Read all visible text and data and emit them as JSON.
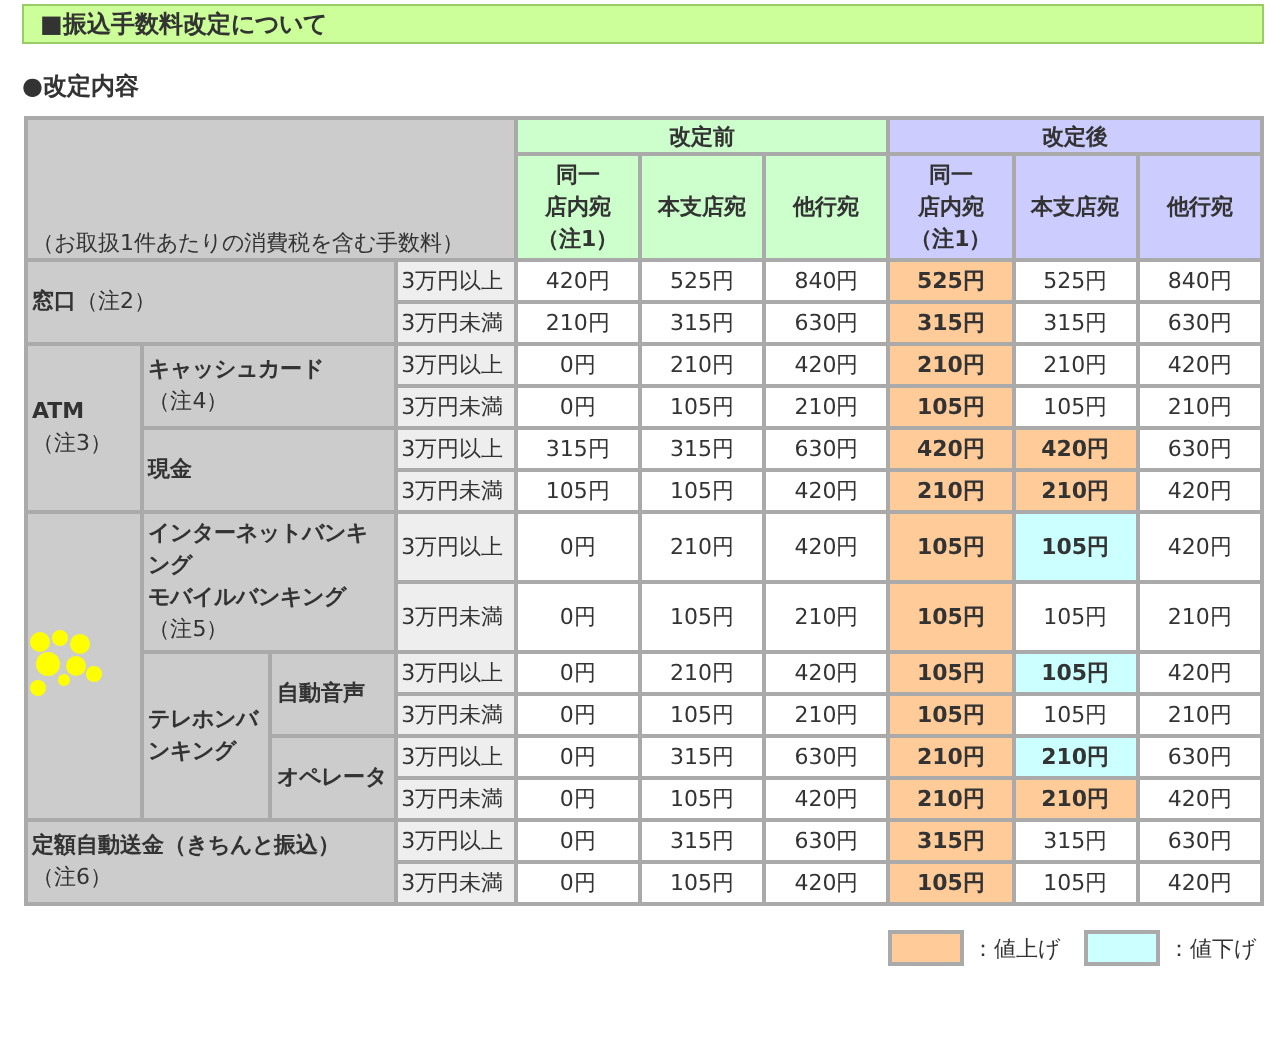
{
  "title": "■振込手数料改定について",
  "section_heading": "●改定内容",
  "table": {
    "corner_note": "（お取扱1件あたりの消費税を含む手数料）",
    "groups": [
      {
        "label": "改定前",
        "kind": "before"
      },
      {
        "label": "改定後",
        "kind": "after"
      }
    ],
    "columns": [
      {
        "lines": [
          "同一",
          "店内宛",
          "（注1）"
        ],
        "kind": "before"
      },
      {
        "lines": [
          "本支店宛"
        ],
        "kind": "before"
      },
      {
        "lines": [
          "他行宛"
        ],
        "kind": "before"
      },
      {
        "lines": [
          "同一",
          "店内宛",
          "（注1）"
        ],
        "kind": "after"
      },
      {
        "lines": [
          "本支店宛"
        ],
        "kind": "after"
      },
      {
        "lines": [
          "他行宛"
        ],
        "kind": "after"
      }
    ],
    "rows": [
      {
        "labels": [
          {
            "kind": "inline_note",
            "lines": [
              "窓口"
            ],
            "note": "（注2）",
            "rowspan": 2,
            "colspan": 3
          }
        ],
        "threshold": "3万円以上",
        "before": [
          "420円",
          "525円",
          "840円"
        ],
        "after": [
          {
            "value": "525円",
            "raised": true,
            "lowered": false
          },
          {
            "value": "525円",
            "raised": false,
            "lowered": false
          },
          {
            "value": "840円",
            "raised": false,
            "lowered": false
          }
        ]
      },
      {
        "threshold": "3万円未満",
        "before": [
          "210円",
          "315円",
          "630円"
        ],
        "after": [
          {
            "value": "315円",
            "raised": true,
            "lowered": false
          },
          {
            "value": "315円",
            "raised": false,
            "lowered": false
          },
          {
            "value": "630円",
            "raised": false,
            "lowered": false
          }
        ]
      },
      {
        "labels": [
          {
            "kind": "text",
            "lines": [
              "ATM"
            ],
            "note": "（注3）",
            "rowspan": 4
          },
          {
            "kind": "text",
            "lines": [
              "キャッシュカード"
            ],
            "note": "（注4）",
            "rowspan": 2,
            "colspan": 2
          }
        ],
        "threshold": "3万円以上",
        "before": [
          "0円",
          "210円",
          "420円"
        ],
        "after": [
          {
            "value": "210円",
            "raised": true,
            "lowered": false
          },
          {
            "value": "210円",
            "raised": false,
            "lowered": false
          },
          {
            "value": "420円",
            "raised": false,
            "lowered": false
          }
        ]
      },
      {
        "threshold": "3万円未満",
        "before": [
          "0円",
          "105円",
          "210円"
        ],
        "after": [
          {
            "value": "105円",
            "raised": true,
            "lowered": false
          },
          {
            "value": "105円",
            "raised": false,
            "lowered": false
          },
          {
            "value": "210円",
            "raised": false,
            "lowered": false
          }
        ]
      },
      {
        "labels": [
          {
            "kind": "text",
            "lines": [
              "現金"
            ],
            "rowspan": 2,
            "colspan": 2
          }
        ],
        "threshold": "3万円以上",
        "before": [
          "315円",
          "315円",
          "630円"
        ],
        "after": [
          {
            "value": "420円",
            "raised": true,
            "lowered": false
          },
          {
            "value": "420円",
            "raised": true,
            "lowered": false
          },
          {
            "value": "630円",
            "raised": false,
            "lowered": false
          }
        ]
      },
      {
        "threshold": "3万円未満",
        "before": [
          "105円",
          "105円",
          "420円"
        ],
        "after": [
          {
            "value": "210円",
            "raised": true,
            "lowered": false
          },
          {
            "value": "210円",
            "raised": true,
            "lowered": false
          },
          {
            "value": "420円",
            "raised": false,
            "lowered": false
          }
        ]
      },
      {
        "labels": [
          {
            "kind": "blank",
            "rowspan": 6
          },
          {
            "kind": "text",
            "lines": [
              "インターネットバンキング",
              "モバイルバンキング"
            ],
            "note": "（注5）",
            "rowspan": 2,
            "colspan": 2
          }
        ],
        "threshold": "3万円以上",
        "before": [
          "0円",
          "210円",
          "420円"
        ],
        "after": [
          {
            "value": "105円",
            "raised": true,
            "lowered": false
          },
          {
            "value": "105円",
            "raised": false,
            "lowered": true
          },
          {
            "value": "420円",
            "raised": false,
            "lowered": false
          }
        ]
      },
      {
        "threshold": "3万円未満",
        "before": [
          "0円",
          "105円",
          "210円"
        ],
        "after": [
          {
            "value": "105円",
            "raised": true,
            "lowered": false
          },
          {
            "value": "105円",
            "raised": false,
            "lowered": false
          },
          {
            "value": "210円",
            "raised": false,
            "lowered": false
          }
        ]
      },
      {
        "labels": [
          {
            "kind": "text",
            "lines": [
              "テレホンバンキング"
            ],
            "rowspan": 4
          },
          {
            "kind": "text",
            "lines": [
              "自動音声"
            ],
            "rowspan": 2
          }
        ],
        "threshold": "3万円以上",
        "before": [
          "0円",
          "210円",
          "420円"
        ],
        "after": [
          {
            "value": "105円",
            "raised": true,
            "lowered": false
          },
          {
            "value": "105円",
            "raised": false,
            "lowered": true
          },
          {
            "value": "420円",
            "raised": false,
            "lowered": false
          }
        ]
      },
      {
        "threshold": "3万円未満",
        "before": [
          "0円",
          "105円",
          "210円"
        ],
        "after": [
          {
            "value": "105円",
            "raised": true,
            "lowered": false
          },
          {
            "value": "105円",
            "raised": false,
            "lowered": false
          },
          {
            "value": "210円",
            "raised": false,
            "lowered": false
          }
        ]
      },
      {
        "labels": [
          {
            "kind": "text",
            "lines": [
              "オペレータ"
            ],
            "rowspan": 2
          }
        ],
        "threshold": "3万円以上",
        "before": [
          "0円",
          "315円",
          "630円"
        ],
        "after": [
          {
            "value": "210円",
            "raised": true,
            "lowered": false
          },
          {
            "value": "210円",
            "raised": false,
            "lowered": true
          },
          {
            "value": "630円",
            "raised": false,
            "lowered": false
          }
        ]
      },
      {
        "threshold": "3万円未満",
        "before": [
          "0円",
          "105円",
          "420円"
        ],
        "after": [
          {
            "value": "210円",
            "raised": true,
            "lowered": false
          },
          {
            "value": "210円",
            "raised": true,
            "lowered": false
          },
          {
            "value": "420円",
            "raised": false,
            "lowered": false
          }
        ]
      },
      {
        "labels": [
          {
            "kind": "text",
            "lines": [
              "定額自動送金（きちんと振込）"
            ],
            "note": "（注6）",
            "rowspan": 2,
            "colspan": 3
          }
        ],
        "threshold": "3万円以上",
        "before": [
          "0円",
          "315円",
          "630円"
        ],
        "after": [
          {
            "value": "315円",
            "raised": true,
            "lowered": false
          },
          {
            "value": "315円",
            "raised": false,
            "lowered": false
          },
          {
            "value": "630円",
            "raised": false,
            "lowered": false
          }
        ]
      },
      {
        "threshold": "3万円未満",
        "before": [
          "0円",
          "105円",
          "420円"
        ],
        "after": [
          {
            "value": "105円",
            "raised": true,
            "lowered": false
          },
          {
            "value": "105円",
            "raised": false,
            "lowered": false
          },
          {
            "value": "420円",
            "raised": false,
            "lowered": false
          }
        ]
      }
    ]
  },
  "legend": [
    {
      "label": "：値上げ",
      "color": "#ffcc99"
    },
    {
      "label": "：値下げ",
      "color": "#ccffff"
    }
  ]
}
